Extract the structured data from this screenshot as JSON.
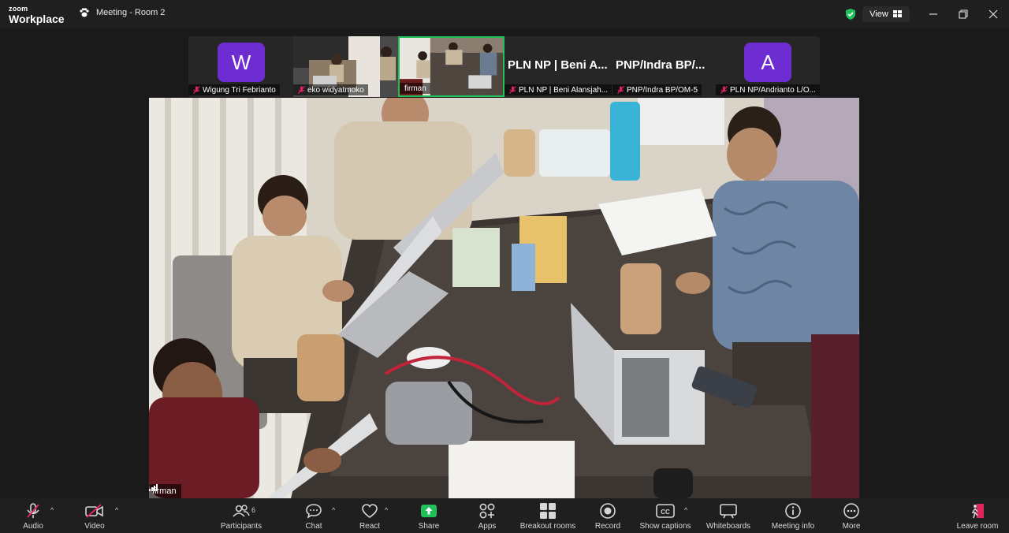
{
  "app": {
    "logo_line1": "zoom",
    "logo_line2": "Workplace"
  },
  "title": {
    "meeting_title": "Meeting - Room 2",
    "view_label": "View"
  },
  "thumbnails": [
    {
      "name": "Wigung Tri Febrianto",
      "avatar_letter": "W",
      "muted": true
    },
    {
      "name": "eko widyatmoko",
      "muted": true
    },
    {
      "name": "firman",
      "muted": false,
      "active": true
    },
    {
      "name": "PLN NP | Beni Alansjah...",
      "big_name": "PLN NP | Beni A...",
      "muted": true
    },
    {
      "name": "PNP/Indra BP/OM-5",
      "big_name": "PNP/Indra BP/...",
      "muted": true
    },
    {
      "name": "PLN NP/Andrianto L/O...",
      "avatar_letter": "A",
      "muted": true
    }
  ],
  "main_video": {
    "speaker_name": "firman"
  },
  "toolbar": {
    "audio": "Audio",
    "video": "Video",
    "participants": "Participants",
    "participants_count": "6",
    "chat": "Chat",
    "react": "React",
    "share": "Share",
    "apps": "Apps",
    "breakout": "Breakout rooms",
    "record": "Record",
    "captions": "Show captions",
    "whiteboards": "Whiteboards",
    "meeting_info": "Meeting info",
    "more": "More",
    "leave": "Leave room"
  },
  "colors": {
    "active_border": "#22c05a",
    "avatar": "#6e2dd1",
    "share": "#22c05a",
    "muted": "#e0245e"
  }
}
